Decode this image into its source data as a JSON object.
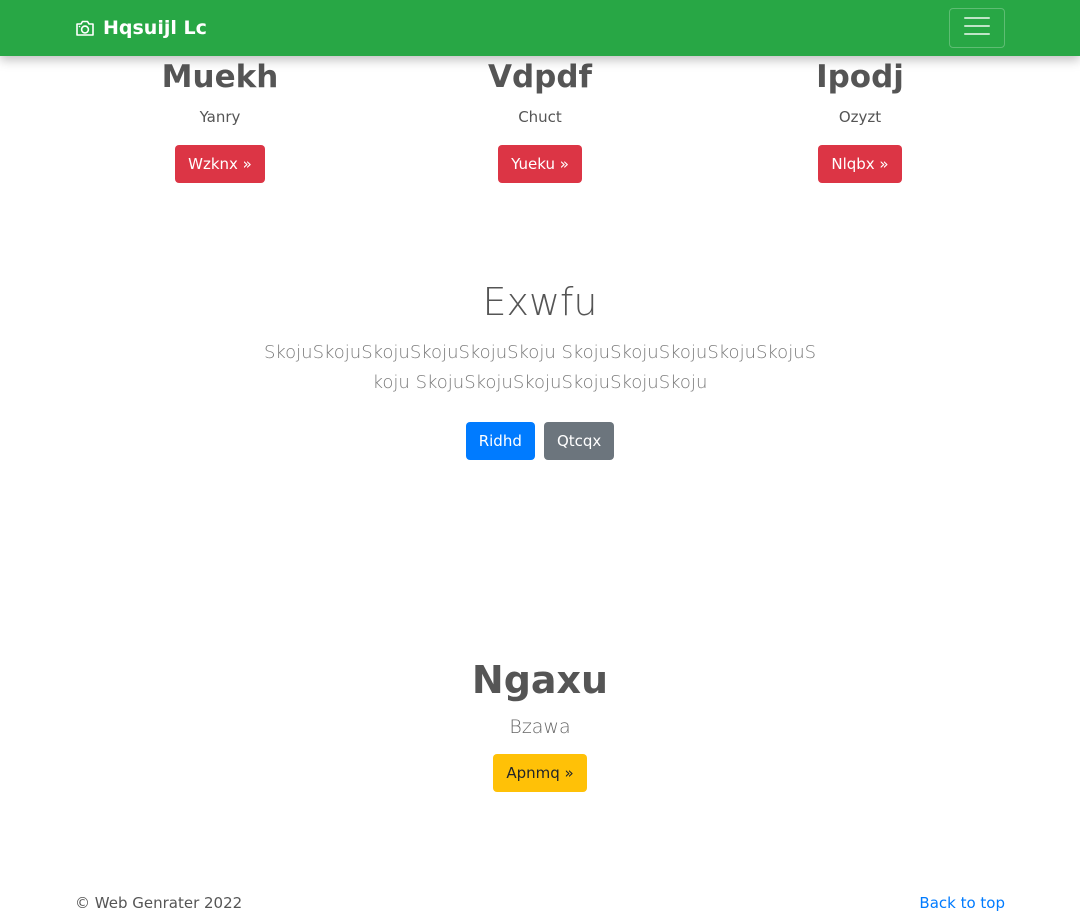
{
  "navbar": {
    "brand_icon": "camera-icon",
    "brand_text": "Hqsuijl Lc",
    "toggler_icon": "hamburger-menu-icon",
    "background_color": "#28a745"
  },
  "features": [
    {
      "title": "Muekh",
      "subtitle": "Yanry",
      "button_label": "Wzknx »",
      "button_color": "#dc3545"
    },
    {
      "title": "Vdpdf",
      "subtitle": "Chuct",
      "button_label": "Yueku »",
      "button_color": "#dc3545"
    },
    {
      "title": "Ipodj",
      "subtitle": "Ozyzt",
      "button_label": "Nlqbx »",
      "button_color": "#dc3545"
    }
  ],
  "hero": {
    "title": "Exwfu",
    "lead": "SkojuSkojuSkojuSkojuSkojuSkoju SkojuSkojuSkojuSkojuSkojuSkoju SkojuSkojuSkojuSkojuSkojuSkoju",
    "primary_button": "Ridhd",
    "secondary_button": "Qtcqx"
  },
  "feature_bottom": {
    "title": "Ngaxu",
    "subtitle": "Bzawa",
    "button_label": "Apnmq »",
    "button_color": "#ffc107"
  },
  "footer": {
    "copyright": "© Web Genrater 2022",
    "back_to_top": "Back to top"
  }
}
